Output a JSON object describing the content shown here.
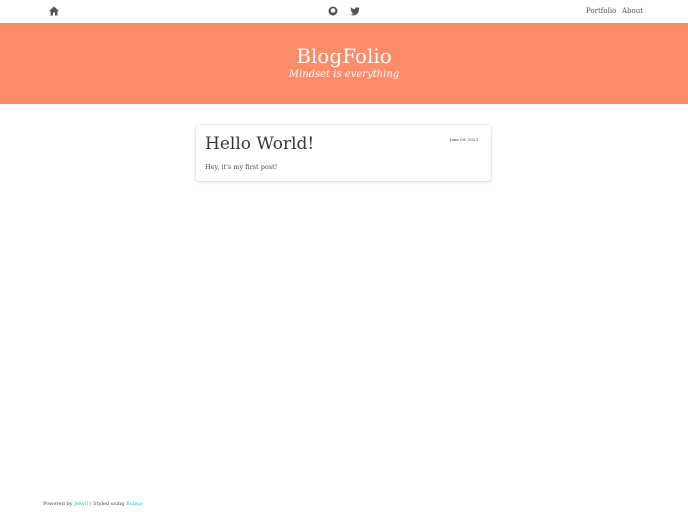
{
  "nav": {
    "links": [
      "Portfolio",
      "About"
    ]
  },
  "hero": {
    "title": "BlogFolio",
    "subtitle": "Mindset is everything"
  },
  "post": {
    "title": "Hello World!",
    "date": "June 09, 2023",
    "excerpt": "Hey, it's my first post!"
  },
  "footer": {
    "powered": "Powered by ",
    "jekyll": "Jekyll",
    "sep": " / Styled using ",
    "bulma": "Bulma"
  },
  "colors": {
    "hero": "#ff8c69",
    "link": "#00d1b2"
  }
}
